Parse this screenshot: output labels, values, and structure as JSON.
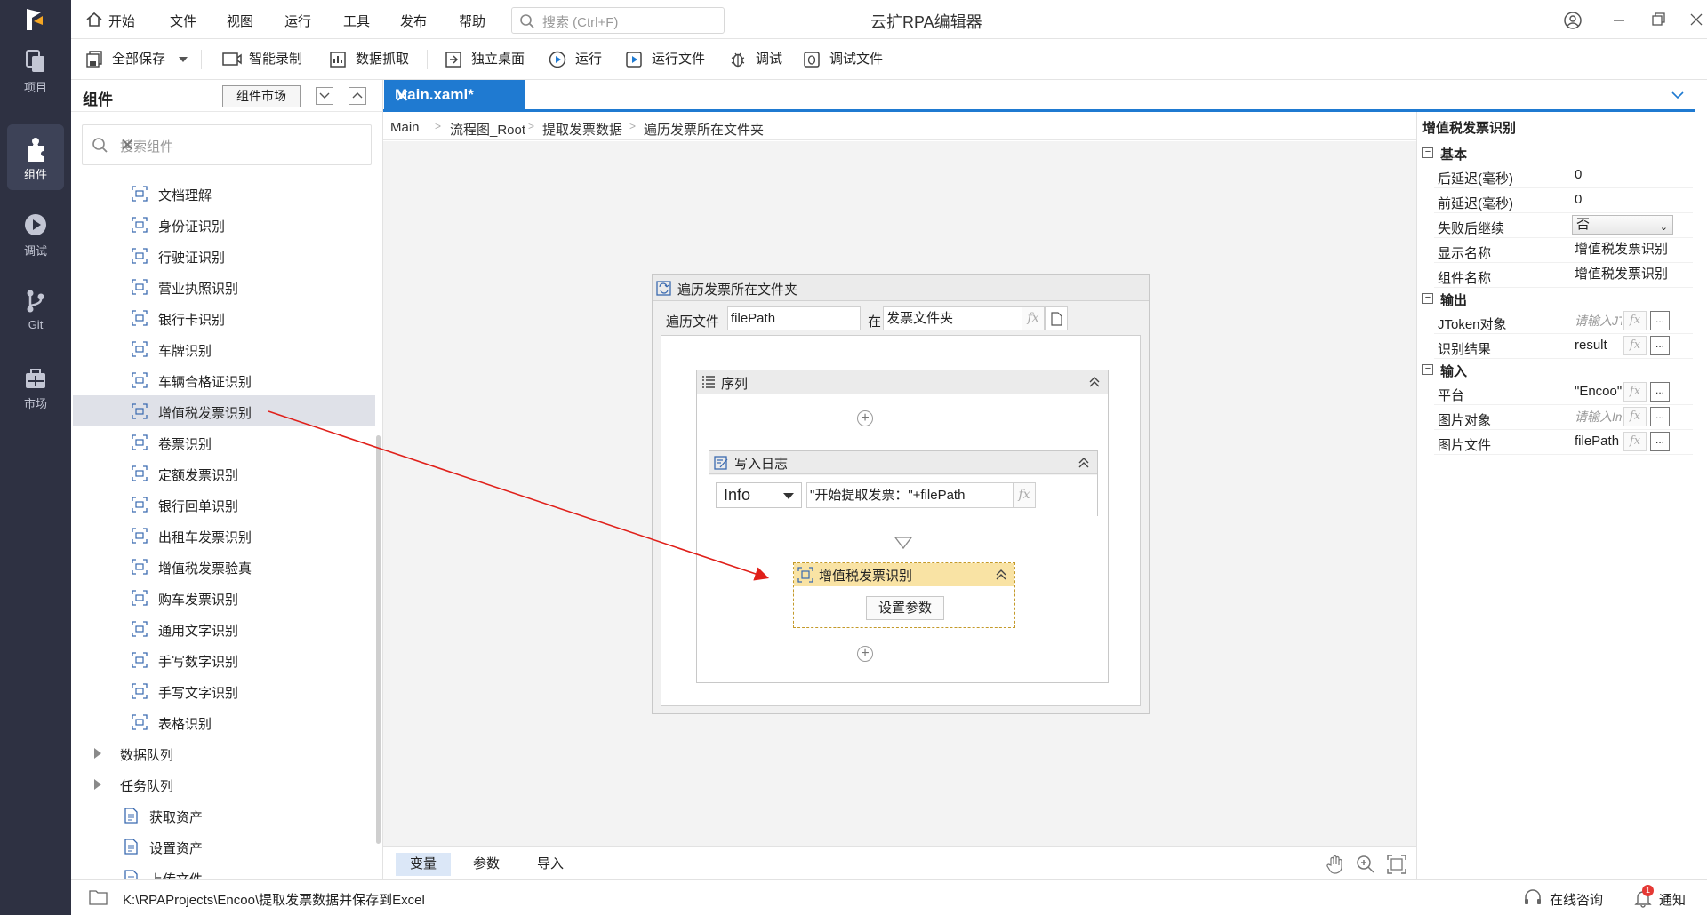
{
  "app": {
    "title": "云扩RPA编辑器",
    "accent_color": "#1f7ad1",
    "rail_color": "#2e3142"
  },
  "rail": {
    "items": [
      {
        "label": "项目",
        "icon": "project-icon"
      },
      {
        "label": "组件",
        "icon": "component-icon",
        "active": true
      },
      {
        "label": "调试",
        "icon": "debug-icon"
      },
      {
        "label": "Git",
        "icon": "git-icon"
      },
      {
        "label": "市场",
        "icon": "market-icon"
      }
    ]
  },
  "menubar": {
    "items": [
      "开始",
      "文件",
      "视图",
      "运行",
      "工具",
      "发布",
      "帮助"
    ],
    "search_placeholder": "搜索 (Ctrl+F)"
  },
  "toolbar": {
    "save_all": "全部保存",
    "smart_record": "智能录制",
    "data_scrape": "数据抓取",
    "independent_desktop": "独立桌面",
    "run": "运行",
    "run_file": "运行文件",
    "debug": "调试",
    "debug_file": "调试文件"
  },
  "component_panel": {
    "title": "组件",
    "market_button": "组件市场",
    "search_placeholder": "搜索组件",
    "items": [
      {
        "label": "文档理解",
        "icon": "doc-understand-icon"
      },
      {
        "label": "身份证识别",
        "icon": "ocr-icon"
      },
      {
        "label": "行驶证识别",
        "icon": "ocr-icon"
      },
      {
        "label": "营业执照识别",
        "icon": "ocr-icon"
      },
      {
        "label": "银行卡识别",
        "icon": "ocr-icon"
      },
      {
        "label": "车牌识别",
        "icon": "ocr-icon"
      },
      {
        "label": "车辆合格证识别",
        "icon": "ocr-icon"
      },
      {
        "label": "增值税发票识别",
        "icon": "ocr-icon",
        "selected": true
      },
      {
        "label": "卷票识别",
        "icon": "ocr-icon"
      },
      {
        "label": "定额发票识别",
        "icon": "ocr-icon"
      },
      {
        "label": "银行回单识别",
        "icon": "ocr-icon"
      },
      {
        "label": "出租车发票识别",
        "icon": "ocr-icon"
      },
      {
        "label": "增值税发票验真",
        "icon": "ocr-verify-icon"
      },
      {
        "label": "购车发票识别",
        "icon": "ocr-icon"
      },
      {
        "label": "通用文字识别",
        "icon": "ocr-icon"
      },
      {
        "label": "手写数字识别",
        "icon": "ocr-icon"
      },
      {
        "label": "手写文字识别",
        "icon": "ocr-icon"
      },
      {
        "label": "表格识别",
        "icon": "ocr-icon"
      }
    ],
    "groups": [
      {
        "label": "数据队列"
      },
      {
        "label": "任务队列"
      }
    ],
    "asset_items": [
      {
        "label": "获取资产",
        "icon": "get-asset-icon"
      },
      {
        "label": "设置资产",
        "icon": "set-asset-icon"
      },
      {
        "label": "上传文件",
        "icon": "upload-file-icon"
      }
    ]
  },
  "editor": {
    "tab_label": "Main.xaml*",
    "breadcrumb": [
      "Main",
      "流程图_Root",
      "提取发票数据",
      "遍历发票所在文件夹"
    ],
    "loop": {
      "title": "遍历发票所在文件夹",
      "iter_label": "遍历文件",
      "iter_var": "filePath",
      "in_label": "在",
      "folder": "发票文件夹"
    },
    "sequence": {
      "title": "序列"
    },
    "log": {
      "title": "写入日志",
      "level": "Info",
      "message": "\"开始提取发票：\"+filePath"
    },
    "ocr_activity": {
      "title": "增值税发票识别",
      "param_button": "设置参数"
    },
    "fx_label": "fx",
    "bottom_tabs": [
      "变量",
      "参数",
      "导入"
    ]
  },
  "properties": {
    "title": "增值税发票识别",
    "groups": [
      {
        "name": "基本",
        "rows": [
          {
            "key": "后延迟(毫秒)",
            "value": "0"
          },
          {
            "key": "前延迟(毫秒)",
            "value": "0"
          },
          {
            "key": "失败后继续",
            "value": "否"
          },
          {
            "key": "显示名称",
            "value": "增值税发票识别"
          },
          {
            "key": "组件名称",
            "value": "增值税发票识别"
          }
        ]
      },
      {
        "name": "输出",
        "rows": [
          {
            "key": "JToken对象",
            "value": "请输入JT"
          },
          {
            "key": "识别结果",
            "value": "result"
          }
        ]
      },
      {
        "name": "输入",
        "rows": [
          {
            "key": "平台",
            "value": "\"Encoo\""
          },
          {
            "key": "图片对象",
            "value": "请输入Im"
          },
          {
            "key": "图片文件",
            "value": "filePath"
          }
        ]
      }
    ]
  },
  "statusbar": {
    "path": "K:\\RPAProjects\\Encoo\\提取发票数据并保存到Excel",
    "consult": "在线咨询",
    "notify": "通知",
    "notify_count": "1"
  }
}
